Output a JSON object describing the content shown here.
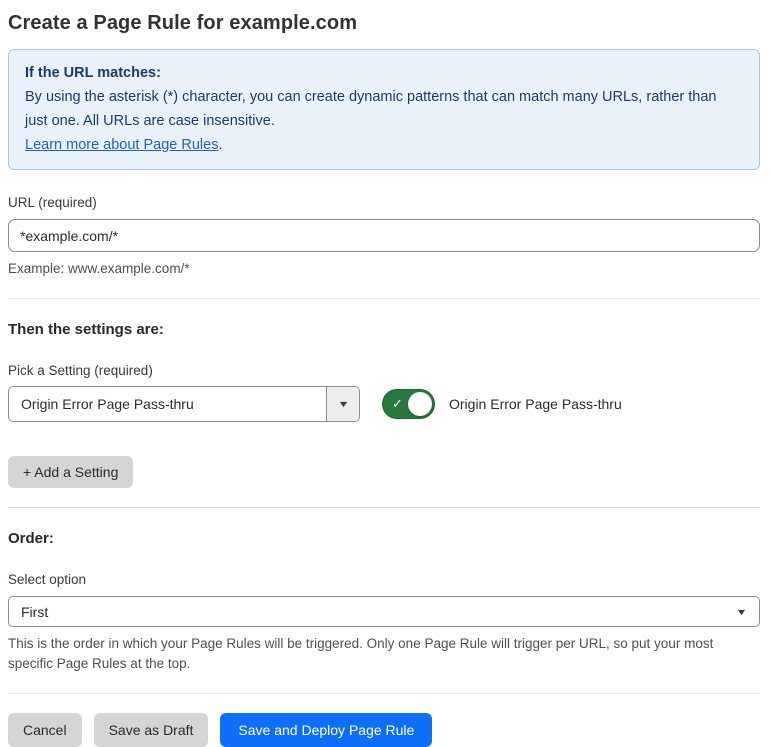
{
  "page": {
    "title": "Create a Page Rule for example.com"
  },
  "info_box": {
    "heading": "If the URL matches:",
    "body": "By using the asterisk (*) character, you can create dynamic patterns that can match many URLs, rather than just one. All URLs are case insensitive.",
    "link_label": "Learn more about Page Rules",
    "link_suffix": "."
  },
  "url_field": {
    "label": "URL (required)",
    "value": "*example.com/*",
    "helper": "Example: www.example.com/*"
  },
  "settings_section": {
    "heading": "Then the settings are:",
    "pick_label": "Pick a Setting (required)",
    "selected_setting": "Origin Error Page Pass-thru",
    "toggle": {
      "state": "on",
      "label": "Origin Error Page Pass-thru"
    },
    "add_button_label": "+ Add a Setting"
  },
  "order_section": {
    "heading": "Order:",
    "select_label": "Select option",
    "selected_option": "First",
    "helper": "This is the order in which your Page Rules will be triggered. Only one Page Rule will trigger per URL, so put your most specific Page Rules at the top."
  },
  "footer": {
    "cancel_label": "Cancel",
    "save_draft_label": "Save as Draft",
    "save_deploy_label": "Save and Deploy Page Rule"
  },
  "icons": {
    "chevron_down": "▼",
    "check": "✓"
  },
  "colors": {
    "info_background": "#e9f2fb",
    "info_border": "#a9c9ea",
    "info_text": "#1b3b6f",
    "link_blue": "#2362be",
    "toggle_green": "#28783e",
    "primary_blue": "#0e6ef6",
    "button_gray": "#d5d5d5",
    "divider_gray": "#e2e2e2"
  }
}
